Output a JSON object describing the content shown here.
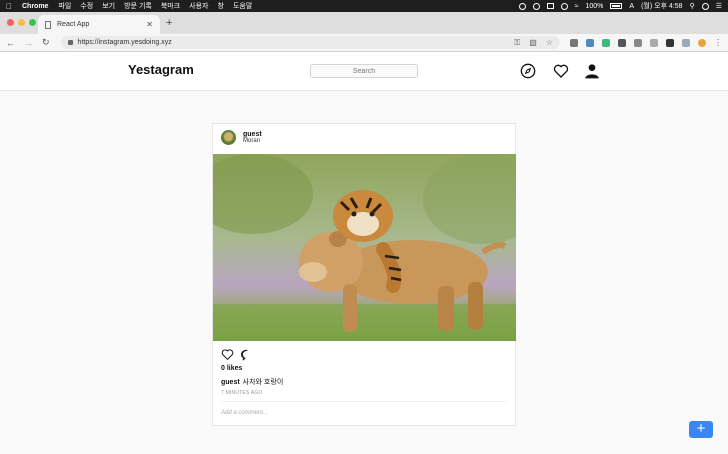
{
  "menubar": {
    "app_name": "Chrome",
    "items": [
      "파일",
      "수정",
      "보기",
      "방문 기록",
      "북마크",
      "사용자",
      "창",
      "도움말"
    ],
    "battery": "100%",
    "clock": "(월) 오후 4:58"
  },
  "browser": {
    "tab_title": "React App",
    "url": "https://instagram.yesdoing.xyz"
  },
  "app": {
    "logo": "Yestagram",
    "search_placeholder": "Search"
  },
  "post": {
    "username": "guest",
    "location": "Moran",
    "likes": "0 likes",
    "caption_user": "guest",
    "caption_text": "사자와 호랑이",
    "timestamp": "7 MINUTES AGO",
    "comment_placeholder": "Add a comment..."
  },
  "fab": {
    "label": "+"
  },
  "colors": {
    "accent": "#3a87f0"
  }
}
